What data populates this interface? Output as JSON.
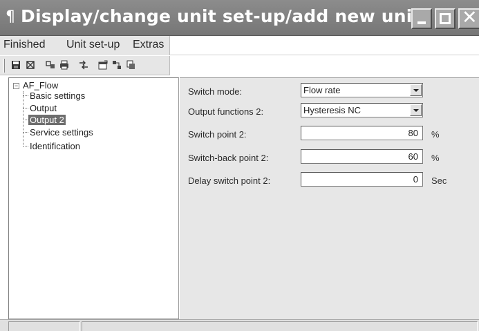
{
  "window": {
    "title": "Display/change unit set-up/add new unit",
    "title_icon": "paragraph-icon"
  },
  "menu": {
    "items": [
      "Finished",
      "Unit set-up",
      "Extras"
    ]
  },
  "toolbar": {
    "icons": [
      "save-icon",
      "settings-icon",
      "compare-icon",
      "print-icon",
      "transfer-icon",
      "properties-icon",
      "network-icon",
      "device-icon"
    ]
  },
  "tree": {
    "root": "AF_Flow",
    "children": [
      "Basic settings",
      "Output",
      "Output 2",
      "Service settings",
      "Identification"
    ],
    "selected": "Output 2"
  },
  "form": {
    "switch_mode": {
      "label": "Switch mode:",
      "value": "Flow rate"
    },
    "output_functions": {
      "label": "Output functions 2:",
      "value": "Hysteresis NC"
    },
    "switch_point": {
      "label": "Switch point 2:",
      "value": "80",
      "unit": "%"
    },
    "switch_back_point": {
      "label": "Switch-back point 2:",
      "value": "60",
      "unit": "%"
    },
    "delay_switch_point": {
      "label": "Delay switch point 2:",
      "value": "0",
      "unit": "Sec"
    }
  },
  "colors": {
    "titlebar": "#808080",
    "selection": "#6e6e6e",
    "panel": "#e7e7e7"
  }
}
